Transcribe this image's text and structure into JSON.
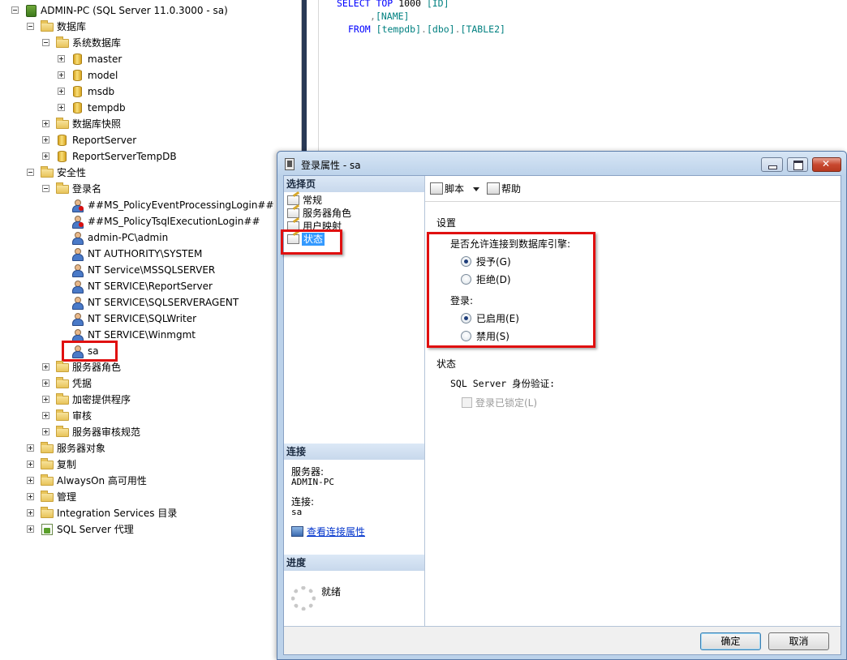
{
  "explorer": {
    "root_label": "ADMIN-PC (SQL Server 11.0.3000 - sa)",
    "items": [
      {
        "label": "数据库"
      },
      {
        "label": "系统数据库"
      },
      {
        "label": "master"
      },
      {
        "label": "model"
      },
      {
        "label": "msdb"
      },
      {
        "label": "tempdb"
      },
      {
        "label": "数据库快照"
      },
      {
        "label": "ReportServer"
      },
      {
        "label": "ReportServerTempDB"
      },
      {
        "label": "安全性"
      },
      {
        "label": "登录名"
      },
      {
        "label": "##MS_PolicyEventProcessingLogin##"
      },
      {
        "label": "##MS_PolicyTsqlExecutionLogin##"
      },
      {
        "label": "admin-PC\\admin"
      },
      {
        "label": "NT AUTHORITY\\SYSTEM"
      },
      {
        "label": "NT Service\\MSSQLSERVER"
      },
      {
        "label": "NT SERVICE\\ReportServer"
      },
      {
        "label": "NT SERVICE\\SQLSERVERAGENT"
      },
      {
        "label": "NT SERVICE\\SQLWriter"
      },
      {
        "label": "NT SERVICE\\Winmgmt"
      },
      {
        "label": "sa"
      },
      {
        "label": "服务器角色"
      },
      {
        "label": "凭据"
      },
      {
        "label": "加密提供程序"
      },
      {
        "label": "审核"
      },
      {
        "label": "服务器审核规范"
      },
      {
        "label": "服务器对象"
      },
      {
        "label": "复制"
      },
      {
        "label": "AlwaysOn 高可用性"
      },
      {
        "label": "管理"
      },
      {
        "label": "Integration Services 目录"
      },
      {
        "label": "SQL Server 代理"
      }
    ]
  },
  "editor": {
    "line1_kw": "SELECT TOP",
    "line1_num": "1000",
    "line1_col": "[ID]",
    "line2_comma": ",",
    "line2_col": "[NAME]",
    "line3_kw": "FROM",
    "line3_db": "[tempdb]",
    "line3_dot1": ".",
    "line3_schema": "[dbo]",
    "line3_dot2": ".",
    "line3_table": "[TABLE2]"
  },
  "dialog": {
    "title": "登录属性 - sa",
    "select_page_header": "选择页",
    "pages": [
      "常规",
      "服务器角色",
      "用户映射",
      "状态"
    ],
    "selected_page": "状态",
    "connection_header": "连接",
    "server_label": "服务器:",
    "server_value": "ADMIN-PC",
    "connection_label": "连接:",
    "connection_value": "sa",
    "view_connection_link": "查看连接属性",
    "progress_header": "进度",
    "progress_status": "就绪",
    "toolbar": {
      "script_label": "脚本",
      "help_label": "帮助"
    },
    "settings_title": "设置",
    "engine_permission_label": "是否允许连接到数据库引擎:",
    "grant_label": "授予(G)",
    "deny_label": "拒绝(D)",
    "login_label": "登录:",
    "enabled_label": "已启用(E)",
    "disabled_label": "禁用(S)",
    "status_title": "状态",
    "auth_label": "SQL Server 身份验证:",
    "locked_label": "登录已锁定(L)",
    "ok_label": "确定",
    "cancel_label": "取消",
    "engine_permission": "grant",
    "login_state": "enabled",
    "locked_checked": false
  },
  "colors": {
    "highlight": "#e01010",
    "selection": "#3399ff",
    "link": "#0033cc",
    "sql_keyword": "#0000ff",
    "sql_identifier": "#008080"
  }
}
